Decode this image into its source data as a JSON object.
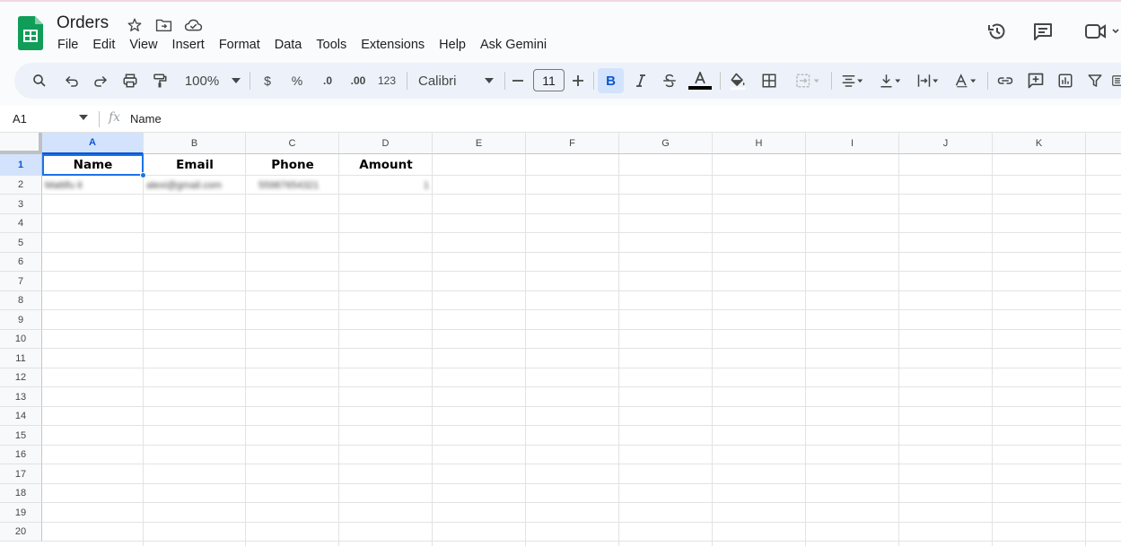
{
  "doc": {
    "title": "Orders"
  },
  "menu": [
    "File",
    "Edit",
    "View",
    "Insert",
    "Format",
    "Data",
    "Tools",
    "Extensions",
    "Help",
    "Ask Gemini"
  ],
  "toolbar": {
    "zoom": "100%",
    "currency": "$",
    "percent": "%",
    "decrease_decimal": ".0",
    "increase_decimal": ".00",
    "number_format": "123",
    "font": "Calibri",
    "font_size": "11",
    "bold": "B"
  },
  "formula_bar": {
    "cell_ref": "A1",
    "fx": "fx",
    "content": "Name"
  },
  "sheet": {
    "columns": [
      "A",
      "B",
      "C",
      "D",
      "E",
      "F",
      "G",
      "H",
      "I",
      "J",
      "K"
    ],
    "rows": [
      "1",
      "2",
      "3",
      "4",
      "5",
      "6",
      "7",
      "8",
      "9",
      "10",
      "11",
      "12",
      "13",
      "14",
      "15",
      "16",
      "17",
      "18",
      "19",
      "20"
    ],
    "header_row": [
      "Name",
      "Email",
      "Phone",
      "Amount"
    ],
    "data_row": [
      "Mattifu it",
      "alexi@gmail.com",
      "55987654321",
      "1"
    ]
  },
  "colors": {
    "accent": "#1a73e8",
    "selected_header": "#d3e3fd",
    "logo_green": "#0f9d58"
  }
}
